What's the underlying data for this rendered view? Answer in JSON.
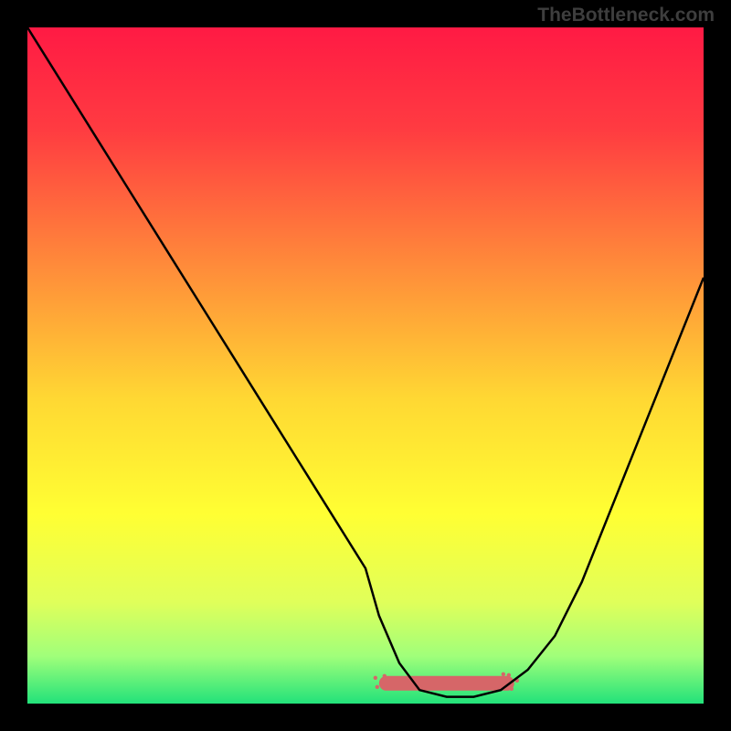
{
  "watermark": "TheBottleneck.com",
  "chart_data": {
    "type": "line",
    "title": "",
    "xlabel": "",
    "ylabel": "",
    "xlim": [
      0,
      100
    ],
    "ylim": [
      0,
      100
    ],
    "background_gradient": {
      "stops": [
        {
          "offset": 0.0,
          "color": "#ff1a44"
        },
        {
          "offset": 0.15,
          "color": "#ff3b41"
        },
        {
          "offset": 0.35,
          "color": "#ff8a3a"
        },
        {
          "offset": 0.55,
          "color": "#ffd833"
        },
        {
          "offset": 0.72,
          "color": "#ffff33"
        },
        {
          "offset": 0.85,
          "color": "#e0ff5a"
        },
        {
          "offset": 0.93,
          "color": "#a0ff7a"
        },
        {
          "offset": 1.0,
          "color": "#22e27a"
        }
      ]
    },
    "series": [
      {
        "name": "curve",
        "x": [
          0,
          5,
          10,
          15,
          20,
          25,
          30,
          35,
          40,
          45,
          50,
          52,
          55,
          58,
          62,
          66,
          70,
          74,
          78,
          82,
          86,
          90,
          94,
          98,
          100
        ],
        "y": [
          100,
          92,
          84,
          76,
          68,
          60,
          52,
          44,
          36,
          28,
          20,
          13,
          6,
          2,
          1,
          1,
          2,
          5,
          10,
          18,
          28,
          38,
          48,
          58,
          63
        ]
      }
    ],
    "flat_zone": {
      "x_start": 52,
      "x_end": 72,
      "y": 3,
      "color": "#d66668",
      "thickness": 16
    }
  }
}
